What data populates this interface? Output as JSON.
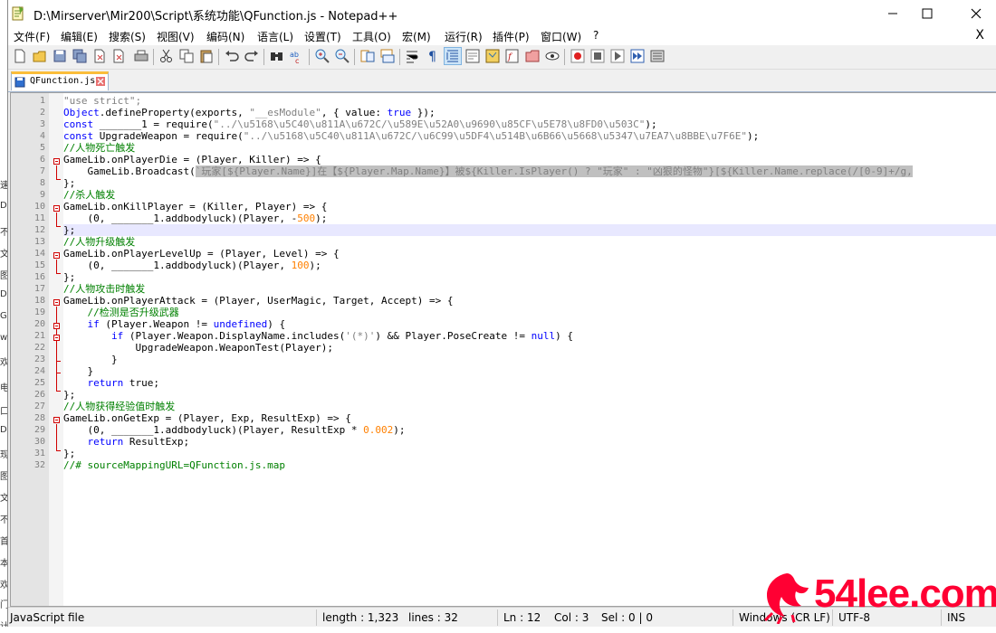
{
  "window": {
    "title": "D:\\Mirserver\\Mir200\\Script\\系统功能\\QFunction.js - Notepad++"
  },
  "menu": {
    "items": [
      "文件(F)",
      "编辑(E)",
      "搜索(S)",
      "视图(V)",
      "编码(N)",
      "语言(L)",
      "设置(T)",
      "工具(O)",
      "宏(M)",
      "运行(R)",
      "插件(P)",
      "窗口(W)",
      "?"
    ],
    "close": "X"
  },
  "toolbar": {
    "icons": [
      "new-file-icon",
      "open-file-icon",
      "save-icon",
      "save-all-icon",
      "close-icon",
      "close-all-icon",
      "print-icon",
      "cut-icon",
      "copy-icon",
      "paste-icon",
      "undo-icon",
      "redo-icon",
      "find-icon",
      "replace-icon",
      "zoom-in-icon",
      "zoom-out-icon",
      "sync-vertical-icon",
      "sync-horizontal-icon",
      "word-wrap-icon",
      "show-all-chars-icon",
      "indent-guide-icon",
      "udl-icon",
      "doc-map-icon",
      "function-list-icon",
      "folder-workspace-icon",
      "monitor-icon",
      "record-macro-icon",
      "stop-macro-icon",
      "play-macro-icon",
      "run-macro-multiple-icon",
      "save-macro-icon"
    ]
  },
  "tab": {
    "label": "QFunction.js"
  },
  "editor": {
    "lines": [
      "1",
      "2",
      "3",
      "4",
      "5",
      "6",
      "7",
      "8",
      "9",
      "10",
      "11",
      "12",
      "13",
      "14",
      "15",
      "16",
      "17",
      "18",
      "19",
      "20",
      "21",
      "22",
      "23",
      "24",
      "25",
      "26",
      "27",
      "28",
      "29",
      "30",
      "31",
      "32"
    ],
    "code": {
      "l1": "\"use strict\";",
      "l2a": "Object",
      "l2b": ".defineProperty(exports, ",
      "l2c": "\"__esModule\"",
      "l2d": ", { value: ",
      "l2e": "true",
      "l2f": " });",
      "l3a": "const",
      "l3b": " _______1 = require(",
      "l3c": "\"../\\u5168\\u5C40\\u811A\\u672C/\\u589E\\u52A0\\u9690\\u85CF\\u5E78\\u8FD0\\u503C\"",
      "l3d": ");",
      "l4a": "const",
      "l4b": " UpgradeWeapon = require(",
      "l4c": "\"../\\u5168\\u5C40\\u811A\\u672C/\\u6C99\\u5DF4\\u514B\\u6B66\\u5668\\u5347\\u7EA7\\u8BBE\\u7F6E\"",
      "l4d": ");",
      "l5": "//人物死亡触发",
      "l6": "GameLib.onPlayerDie = (Player, Killer) => {",
      "l7a": "    GameLib.Broadcast(",
      "l7b": "`玩家[${Player.Name}]在【${Player.Map.Name}】被${Killer.IsPlayer() ? \"玩家\" : \"凶狠的怪物\"}[${Killer.Name.replace(/[0-9]+/g,",
      "l8": "};",
      "l9": "//杀人触发",
      "l10": "GameLib.onKillPlayer = (Killer, Player) => {",
      "l11a": "    (0, _______1.addbodyluck)(Player, -",
      "l11b": "500",
      "l11c": ");",
      "l12": "};",
      "l13": "//人物升级触发",
      "l14": "GameLib.onPlayerLevelUp = (Player, Level) => {",
      "l15a": "    (0, _______1.addbodyluck)(Player, ",
      "l15b": "100",
      "l15c": ");",
      "l16": "};",
      "l17": "//人物攻击时触发",
      "l18": "GameLib.onPlayerAttack = (Player, UserMagic, Target, Accept) => {",
      "l19": "    //检测是否升级武器",
      "l20a": "    if",
      "l20b": " (Player.Weapon != ",
      "l20c": "undefined",
      "l20d": ") {",
      "l21a": "        if",
      "l21b": " (Player.Weapon.DisplayName.includes(",
      "l21c": "'(*)'",
      "l21d": ") && Player.PoseCreate != ",
      "l21e": "null",
      "l21f": ") {",
      "l22": "            UpgradeWeapon.WeaponTest(Player);",
      "l23": "        }",
      "l24": "    }",
      "l25a": "    return",
      "l25b": " true;",
      "l26": "};",
      "l27": "//人物获得经验值时触发",
      "l28": "GameLib.onGetExp = (Player, Exp, ResultExp) => {",
      "l29a": "    (0, _______1.addbodyluck)(Player, ResultExp * ",
      "l29b": "0.002",
      "l29c": ");",
      "l30a": "    return",
      "l30b": " ResultExp;",
      "l31": "};",
      "l32": "//# sourceMappingURL=QFunction.js.map"
    }
  },
  "status": {
    "filetype": "JavaScript file",
    "length": "length : 1,323",
    "lines": "lines : 32",
    "ln": "Ln : 12",
    "col": "Col : 3",
    "sel": "Sel : 0 | 0",
    "eol": "Windows (CR LF)",
    "encoding": "UTF-8",
    "mode": "INS"
  },
  "watermark": {
    "text": "54lee.com"
  },
  "background_window": {
    "chars": [
      "速",
      "De",
      "不",
      "文",
      "图",
      "Da",
      "GO",
      "w",
      "欢",
      "电",
      "口",
      "De",
      "现",
      "图",
      "文",
      "不",
      "首",
      "本",
      "欢",
      "门",
      "计"
    ]
  },
  "colors": {
    "keyword": "#0000ff",
    "string": "#808080",
    "number": "#ff8000",
    "comment": "#008000",
    "tab_accent": "#fabd3a",
    "fold_marker": "#d00000",
    "current_line": "#e8e8ff"
  }
}
